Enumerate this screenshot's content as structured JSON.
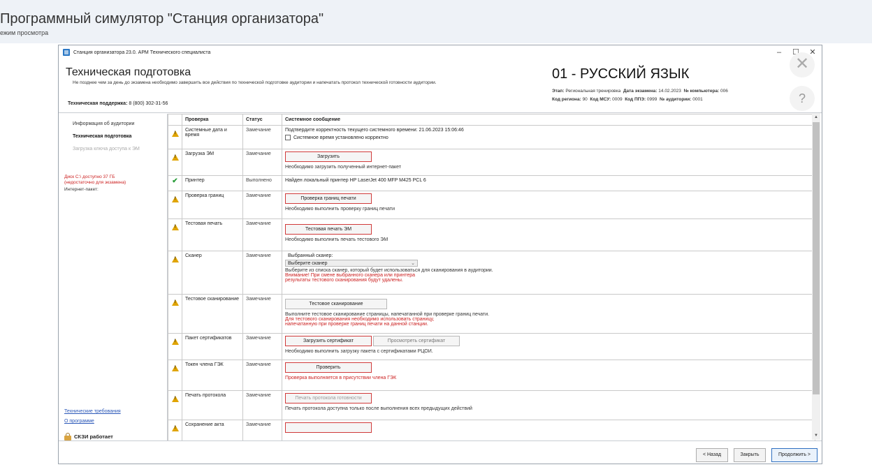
{
  "outer": {
    "title": "Программный симулятор \"Станция организатора\"",
    "mode": "ежим просмотра"
  },
  "window": {
    "title": "Станция организатора 23.0. АРМ Технического специалиста",
    "minimize": "–",
    "maximize": "☐",
    "close": "✕"
  },
  "header": {
    "title": "Техническая подготовка",
    "subtitle": "Не позднее чем за день до экзамена необходимо завершить все действия по технической подготовке аудитории и напечатать протокол технической готовности аудитории.",
    "support_label": "Техническая поддержка:",
    "support_phone": "8 (800) 302-31-56",
    "subject": "01 - РУССКИЙ ЯЗЫК",
    "stage_label": "Этап:",
    "stage_value": "Региональная тренировка",
    "date_label": "Дата экзамена:",
    "date_value": "14.02.2023",
    "pc_label": "№ компьютера:",
    "pc_value": "006",
    "region_label": "Код региона:",
    "region_value": "90",
    "msu_label": "Код МСУ:",
    "msu_value": "0009",
    "ppe_label": "Код ППЭ:",
    "ppe_value": "0999",
    "room_label": "№ аудитории:",
    "room_value": "0001",
    "close_glyph": "✕",
    "help_glyph": "?"
  },
  "sidebar": {
    "items": [
      {
        "label": "Информация об аудитории"
      },
      {
        "label": "Техническая подготовка"
      },
      {
        "label": "Загрузка ключа доступа к ЭМ"
      }
    ],
    "disk_line1": "Диск C:\\ доступно 37 ГБ",
    "disk_line2": "(недостаточно для экзамена)",
    "internet": "Интернет-пакет:",
    "link_requirements": "Технические требования",
    "link_about": "О программе",
    "skzi": "СКЗИ работает"
  },
  "table": {
    "headers": {
      "check": "Проверка",
      "status": "Статус",
      "message": "Системное сообщение"
    },
    "rows": {
      "time": {
        "name": "Системные дата и время",
        "status": "Замечание",
        "msg": "Подтвердите корректность текущего системного времени: 21.06.2023 15:06:46",
        "checkbox": "Системное время установлено корректно"
      },
      "em": {
        "name": "Загрузка ЭМ",
        "status": "Замечание",
        "button": "Загрузить",
        "note": "Необходимо загрузить полученный интернет-пакет"
      },
      "printer": {
        "name": "Принтер",
        "status": "Выполнено",
        "msg": "Найден локальный принтер HP LaserJet 400 MFP M425 PCL 6",
        "icon": "✔"
      },
      "borders": {
        "name": "Проверка границ",
        "status": "Замечание",
        "button": "Проверка границ печати",
        "note": "Необходимо выполнить проверку границ печати"
      },
      "testprint": {
        "name": "Тестовая печать",
        "status": "Замечание",
        "button": "Тестовая печать ЭМ",
        "note": "Необходимо выполнить печать тестового ЭМ"
      },
      "scanner": {
        "name": "Сканер",
        "status": "Замечание",
        "label": "Выбранный сканер:",
        "select": "Выберите сканер",
        "note": "Выберите из списка сканер, который будет использоваться для сканирования в аудитории.",
        "warn1": "Внимание! При смене выбранного сканера или принтера",
        "warn2": "результаты тестового сканирования будут удалены."
      },
      "testscan": {
        "name": "Тестовое сканирование",
        "status": "Замечание",
        "button": "Тестовое сканирование",
        "note": "Выполните тестовое сканирование страницы, напечатанной при проверке границ печати.",
        "warn1": "Для тестового сканирования необходимо использовать страницу,",
        "warn2": "напечатанную при проверке границ печати на данной станции."
      },
      "certs": {
        "name": "Пакет сертификатов",
        "status": "Замечание",
        "button": "Загрузить сертификат",
        "button2": "Просмотреть сертификат",
        "note": "Необходимо выполнить загрузку пакета с сертификатами РЦОИ."
      },
      "gek": {
        "name": "Токен члена ГЭК",
        "status": "Замечание",
        "button": "Проверить",
        "note": "Проверка выполняется в присутствии члена ГЭК"
      },
      "protocol": {
        "name": "Печать протокола",
        "status": "Замечание",
        "button": "Печать протокола готовности",
        "note": "Печать протокола доступна только после выполнения всех предыдущих действий"
      },
      "act": {
        "name": "Сохранение акта",
        "status": "Замечание"
      }
    }
  },
  "scroll": {
    "up": "▲",
    "down": "▼"
  },
  "footer": {
    "back": "< Назад",
    "close": "Закрыть",
    "next": "Продолжить >"
  }
}
